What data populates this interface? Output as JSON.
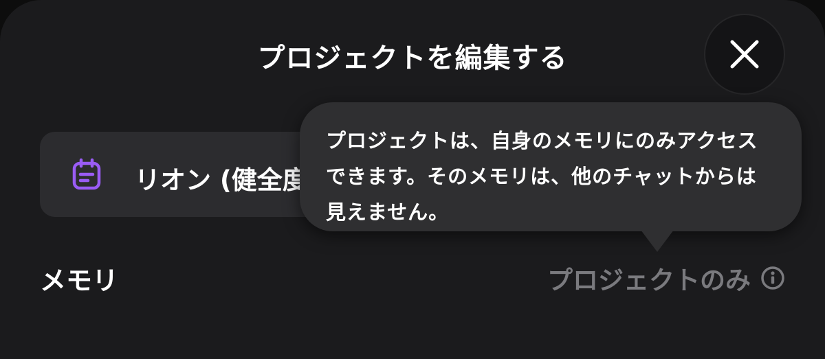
{
  "header": {
    "title": "プロジェクトを編集する",
    "close_icon": "close-icon"
  },
  "project": {
    "name": "リオン (健全度",
    "icon": "notepad-icon",
    "icon_color": "#9a5cf5"
  },
  "memory": {
    "label": "メモリ",
    "value": "プロジェクトのみ",
    "info_icon": "info-icon"
  },
  "tooltip": {
    "text": "プロジェクトは、自身のメモリにのみアクセスできます。そのメモリは、他のチャットからは見えません。"
  },
  "colors": {
    "background": "#1b1b1d",
    "field": "#2c2c2f",
    "tooltip": "#2f2f31",
    "muted_text": "#7a7a7e"
  }
}
